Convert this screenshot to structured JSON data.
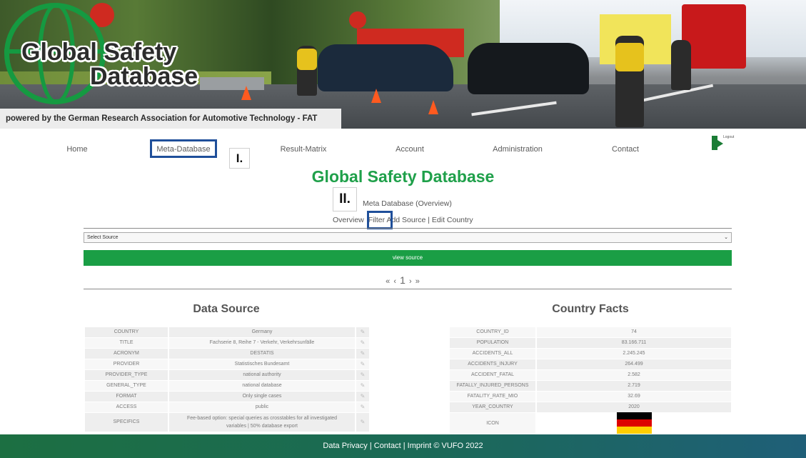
{
  "banner": {
    "logo_line1": "Global Safety",
    "logo_line2": "Database",
    "tagline": "powered by the German Research Association for Automotive Technology - FAT"
  },
  "nav": {
    "items": [
      "Home",
      "Meta-Database",
      "Result-Matrix",
      "Account",
      "Administration",
      "Contact"
    ],
    "logout_label": "Logout"
  },
  "markers": {
    "first": "I.",
    "second": "II."
  },
  "page": {
    "title": "Global Safety Database",
    "subtitle": "Meta Database (Overview)",
    "subnav": {
      "overview": "Overview",
      "filter": "Filter",
      "add_source": "Add Source",
      "separator": "|",
      "edit_country": "Edit Country"
    }
  },
  "source_select": {
    "value": "Select Source"
  },
  "view_button": {
    "label": "view source"
  },
  "pager": {
    "first": "«",
    "prev": "‹",
    "current": "1",
    "next": "›",
    "last": "»"
  },
  "data_source": {
    "title": "Data Source",
    "rows": [
      {
        "key": "COUNTRY",
        "value": "Germany"
      },
      {
        "key": "TITLE",
        "value": "Fachserie 8, Reihe 7 - Verkehr, Verkehrsunfälle"
      },
      {
        "key": "ACRONYM",
        "value": "DESTATIS"
      },
      {
        "key": "PROVIDER",
        "value": "Statistisches Bundesamt"
      },
      {
        "key": "PROVIDER_TYPE",
        "value": "national authority"
      },
      {
        "key": "GENERAL_TYPE",
        "value": "national database"
      },
      {
        "key": "FORMAT",
        "value": "Only single cases"
      },
      {
        "key": "ACCESS",
        "value": "public"
      },
      {
        "key": "SPECIFICS",
        "value_line1": "Fee-based option: special queries as crosstables for all investigated",
        "value_line2": "variables | 50% database export"
      }
    ]
  },
  "country_facts": {
    "title": "Country Facts",
    "rows": [
      {
        "key": "COUNTRY_ID",
        "value": "74"
      },
      {
        "key": "POPULATION",
        "value": "83.166.711"
      },
      {
        "key": "ACCIDENTS_ALL",
        "value": "2.245.245"
      },
      {
        "key": "ACCIDENTS_INJURY",
        "value": "264.499"
      },
      {
        "key": "ACCIDENT_FATAL",
        "value": "2.582"
      },
      {
        "key": "FATALLY_INJURED_PERSONS",
        "value": "2.719"
      },
      {
        "key": "FATALITY_RATE_MIO",
        "value": "32.69"
      },
      {
        "key": "YEAR_COUNTRY",
        "value": "2020"
      },
      {
        "key": "ICON",
        "value": "flag-germany-icon"
      }
    ],
    "flag_colors": [
      "#000000",
      "#dd0000",
      "#ffce00"
    ]
  },
  "footer": {
    "privacy": "Data Privacy",
    "contact": "Contact",
    "imprint": "Imprint",
    "copyright": "© VUFO 2022",
    "separator": "|"
  }
}
